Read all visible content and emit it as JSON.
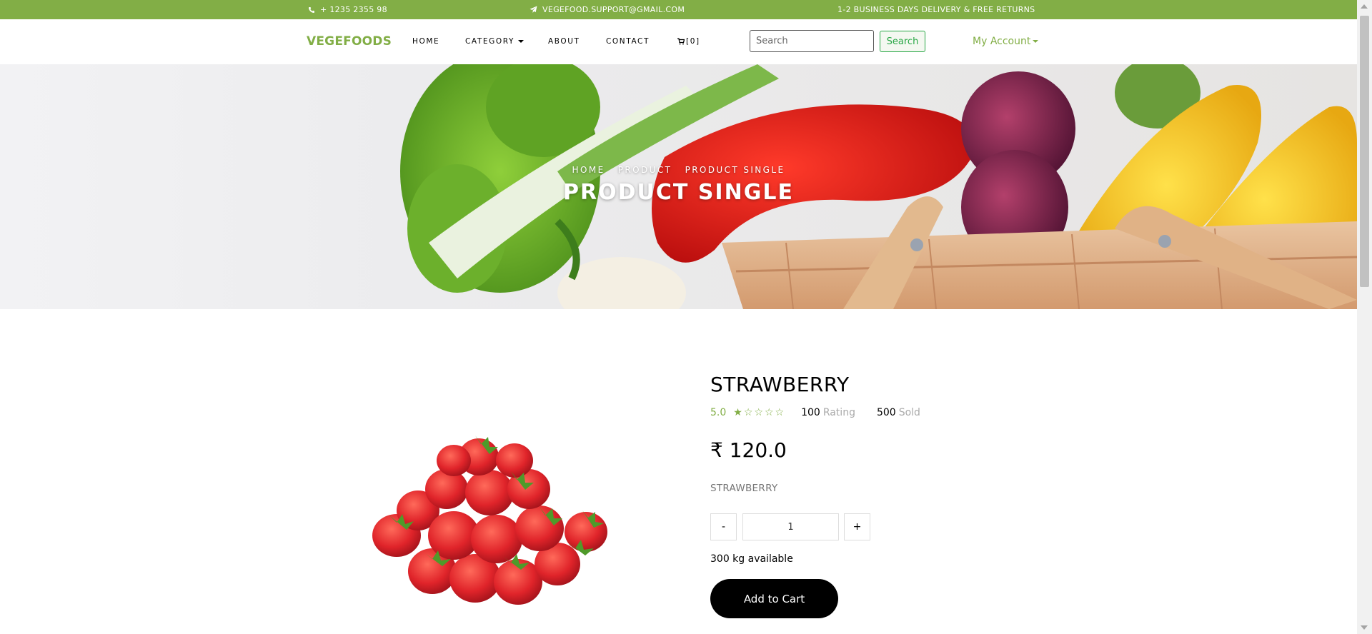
{
  "topbar": {
    "phone": "+ 1235 2355 98",
    "email": "VEGEFOOD.SUPPORT@GMAIL.COM",
    "notice": "1-2 BUSINESS DAYS DELIVERY & FREE RETURNS",
    "phone_icon": "phone-icon",
    "email_icon": "paper-plane-icon"
  },
  "navbar": {
    "brand": "VEGEFOODS",
    "links": [
      "HOME",
      "CATEGORY",
      "ABOUT",
      "CONTACT"
    ],
    "cart_label": "[0]",
    "cart_icon": "cart-icon",
    "search_placeholder": "Search",
    "search_button": "Search",
    "account": "My Account"
  },
  "hero": {
    "breadcrumb": [
      "HOME",
      "PRODUCT",
      "PRODUCT SINGLE"
    ],
    "title": "PRODUCT SINGLE"
  },
  "product": {
    "name": "STRAWBERRY",
    "rating_score": "5.0",
    "stars_filled": 1,
    "stars_total": 5,
    "rating_count": "100",
    "rating_label": "Rating",
    "sold_count": "500",
    "sold_label": "Sold",
    "price": "₹ 120.0",
    "description": "STRAWBERRY",
    "qty_minus": "-",
    "qty_value": "1",
    "qty_plus": "+",
    "availability": "300 kg available",
    "add_to_cart": "Add to Cart"
  },
  "colors": {
    "accent": "#82ae46",
    "search_green": "#28a745",
    "button_black": "#000000"
  }
}
